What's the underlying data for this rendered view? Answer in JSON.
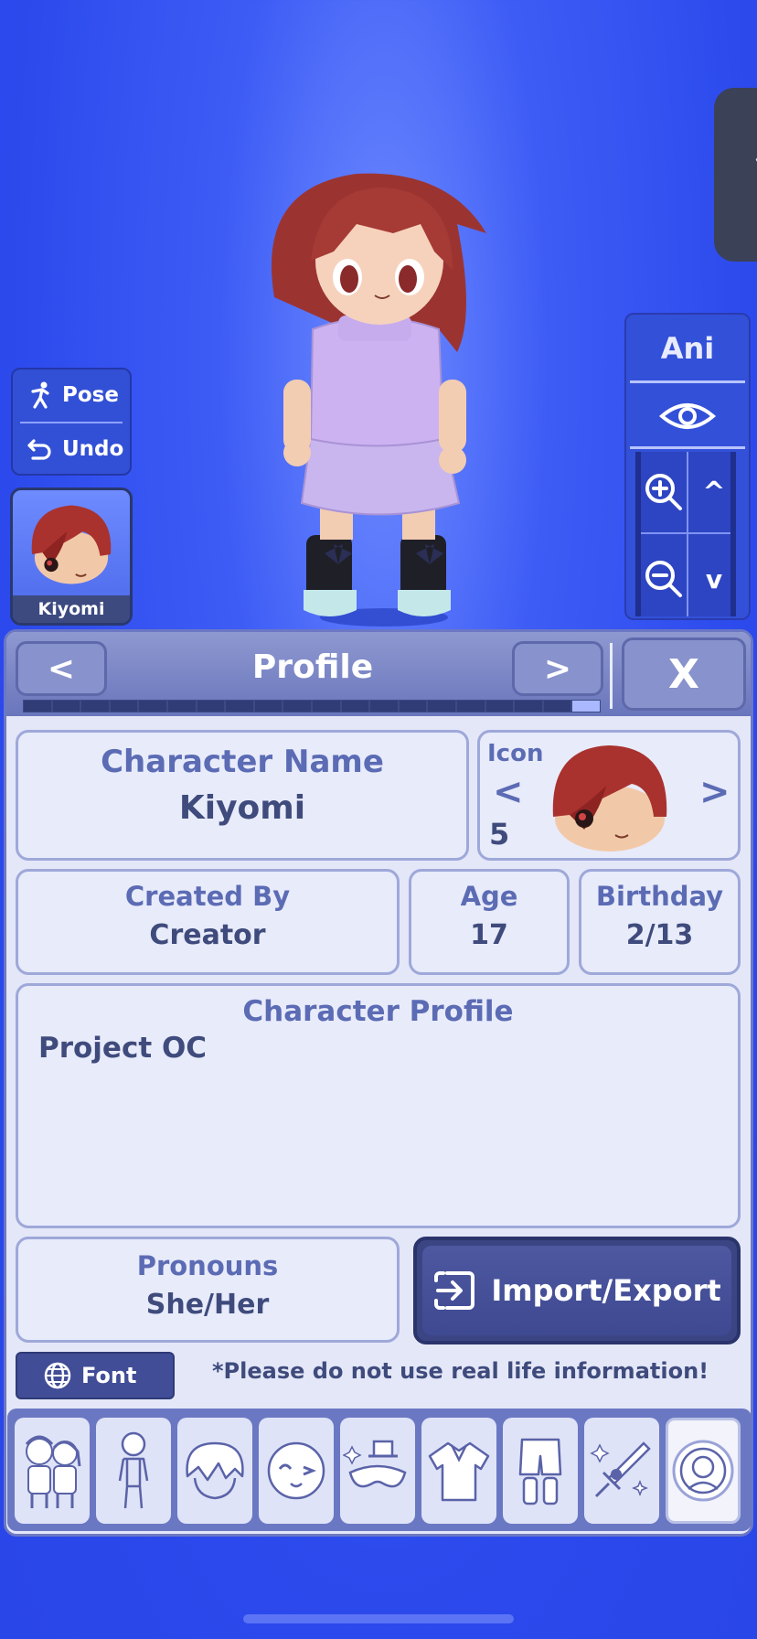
{
  "colors": {
    "background": "#2b49ec",
    "panel": "#d8ddf5",
    "panel_header": "#7a85c5",
    "accent_dark": "#3b4584",
    "label": "#5b6bb4",
    "value": "#3f4b7c"
  },
  "side_tab": {
    "icon": "chevron-left-icon",
    "label": "〈"
  },
  "left_controls": {
    "pose_label": "Pose",
    "undo_label": "Undo",
    "pose_icon": "pose-figure-icon",
    "undo_icon": "undo-arrow-icon"
  },
  "character_thumb": {
    "name": "Kiyomi"
  },
  "right_controls": {
    "ani_label": "Ani",
    "eye_icon": "eye-icon",
    "zoom_in_icon": "zoom-in-icon",
    "zoom_out_icon": "zoom-out-icon",
    "up_icon": "chevron-up-icon",
    "down_icon": "chevron-down-icon",
    "up_label": "^",
    "down_label": "v"
  },
  "panel": {
    "title": "Profile",
    "prev_label": "<",
    "next_label": ">",
    "close_label": "X",
    "progress": {
      "segments": 20,
      "active_index": 19
    },
    "character_name": {
      "label": "Character Name",
      "value": "Kiyomi"
    },
    "icon": {
      "label": "Icon",
      "number": "5",
      "prev": "<",
      "next": ">"
    },
    "created_by": {
      "label": "Created By",
      "value": "Creator"
    },
    "age": {
      "label": "Age",
      "value": "17"
    },
    "birthday": {
      "label": "Birthday",
      "value": "2/13"
    },
    "character_profile": {
      "label": "Character Profile",
      "value": "Project OC"
    },
    "pronouns": {
      "label": "Pronouns",
      "value": "She/Her"
    },
    "import_export": {
      "label": "Import/Export",
      "icon": "import-export-icon"
    },
    "font_button": {
      "label": "Font",
      "icon": "globe-icon"
    },
    "notice": "*Please do not use real life information!"
  },
  "tabs": [
    {
      "name": "characters-tab",
      "icon": "two-characters-icon"
    },
    {
      "name": "body-tab",
      "icon": "body-figure-icon"
    },
    {
      "name": "hair-tab",
      "icon": "hair-icon"
    },
    {
      "name": "face-tab",
      "icon": "face-icon"
    },
    {
      "name": "accessories-tab",
      "icon": "hat-mask-icon"
    },
    {
      "name": "clothes-top-tab",
      "icon": "shirt-icon"
    },
    {
      "name": "clothes-bottom-tab",
      "icon": "pants-icon"
    },
    {
      "name": "items-tab",
      "icon": "sword-sparkle-icon"
    },
    {
      "name": "profile-tab",
      "icon": "profile-avatar-icon",
      "selected": true
    }
  ]
}
